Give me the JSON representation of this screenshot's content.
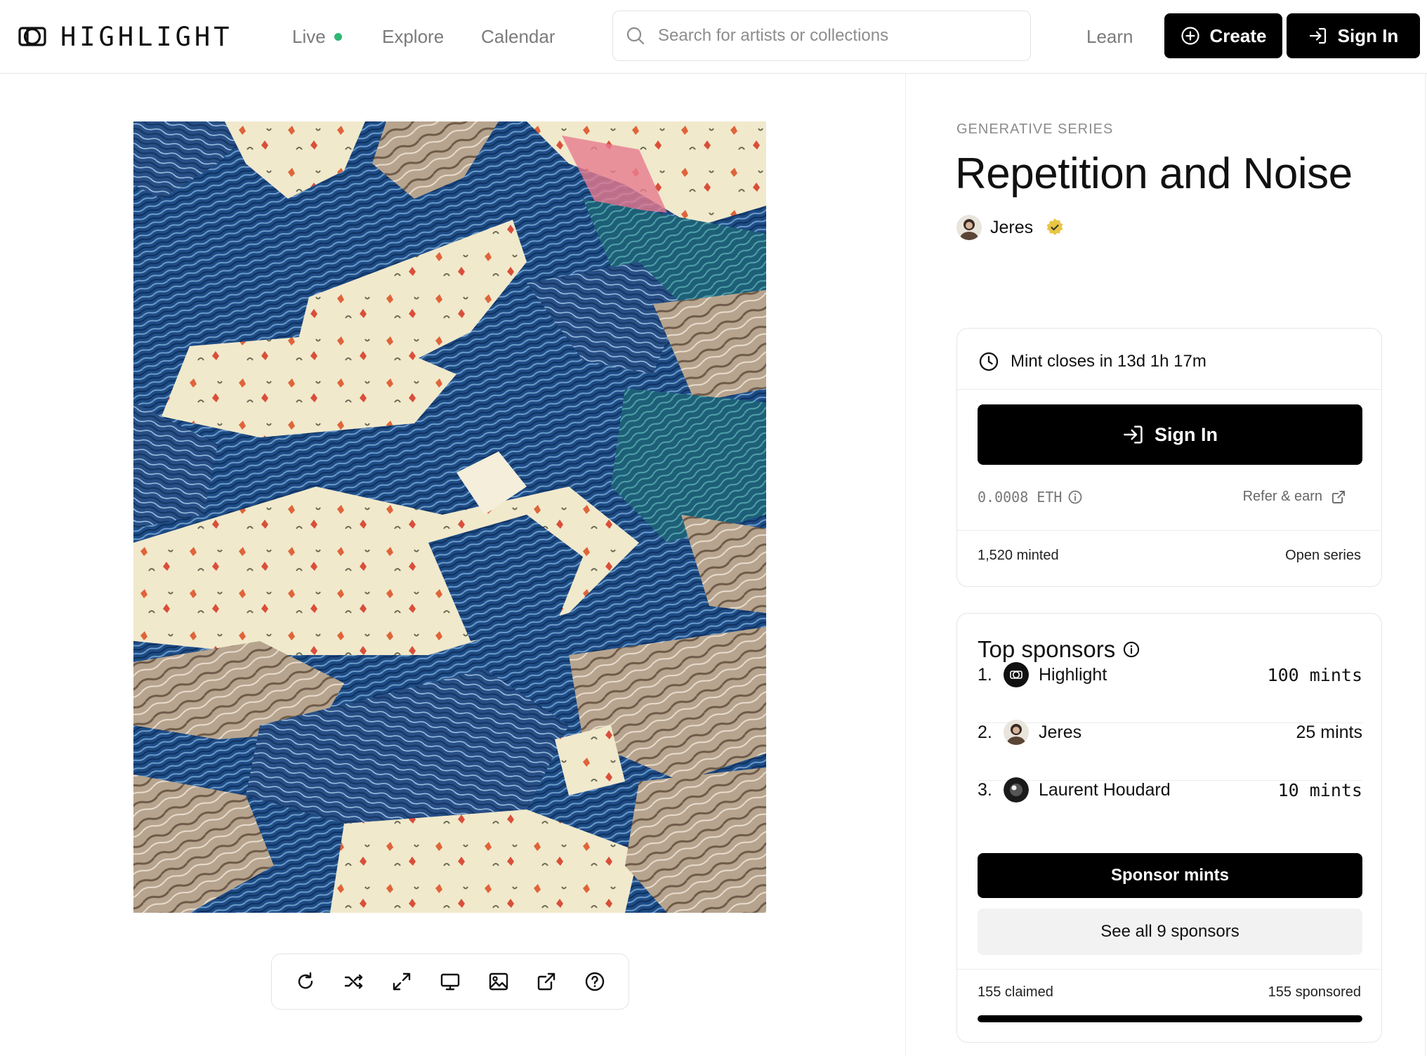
{
  "nav": {
    "logo_text": "HIGHLIGHT",
    "live_label": "Live",
    "explore_label": "Explore",
    "calendar_label": "Calendar",
    "search_placeholder": "Search for artists or collections",
    "learn_label": "Learn",
    "create_label": "Create",
    "signin_label": "Sign In"
  },
  "artwork": {
    "toolbar_icons": [
      "refresh-icon",
      "shuffle-icon",
      "expand-icon",
      "monitor-icon",
      "image-icon",
      "external-link-icon",
      "help-icon"
    ]
  },
  "collection": {
    "kicker": "GENERATIVE SERIES",
    "title": "Repetition and Noise",
    "artist": "Jeres"
  },
  "mint": {
    "closes_text": "Mint closes in 13d 1h 17m",
    "signin_label": "Sign In",
    "price": "0.0008 ETH",
    "refer_label": "Refer & earn",
    "minted": "1,520 minted",
    "series_type": "Open series"
  },
  "sponsors": {
    "title": "Top sponsors",
    "list": [
      {
        "rank": "1.",
        "name": "Highlight",
        "mints": "100 mints"
      },
      {
        "rank": "2.",
        "name": "Jeres",
        "mints": "25 mints"
      },
      {
        "rank": "3.",
        "name": "Laurent Houdard",
        "mints": "10 mints"
      }
    ],
    "sponsor_button": "Sponsor mints",
    "see_all_button": "See all 9 sponsors",
    "claimed": "155 claimed",
    "sponsored": "155 sponsored",
    "progress_fraction": 1.0
  },
  "colors": {
    "accent": "#000000",
    "live_dot": "#2eb872",
    "verified_badge": "#e9c545"
  }
}
